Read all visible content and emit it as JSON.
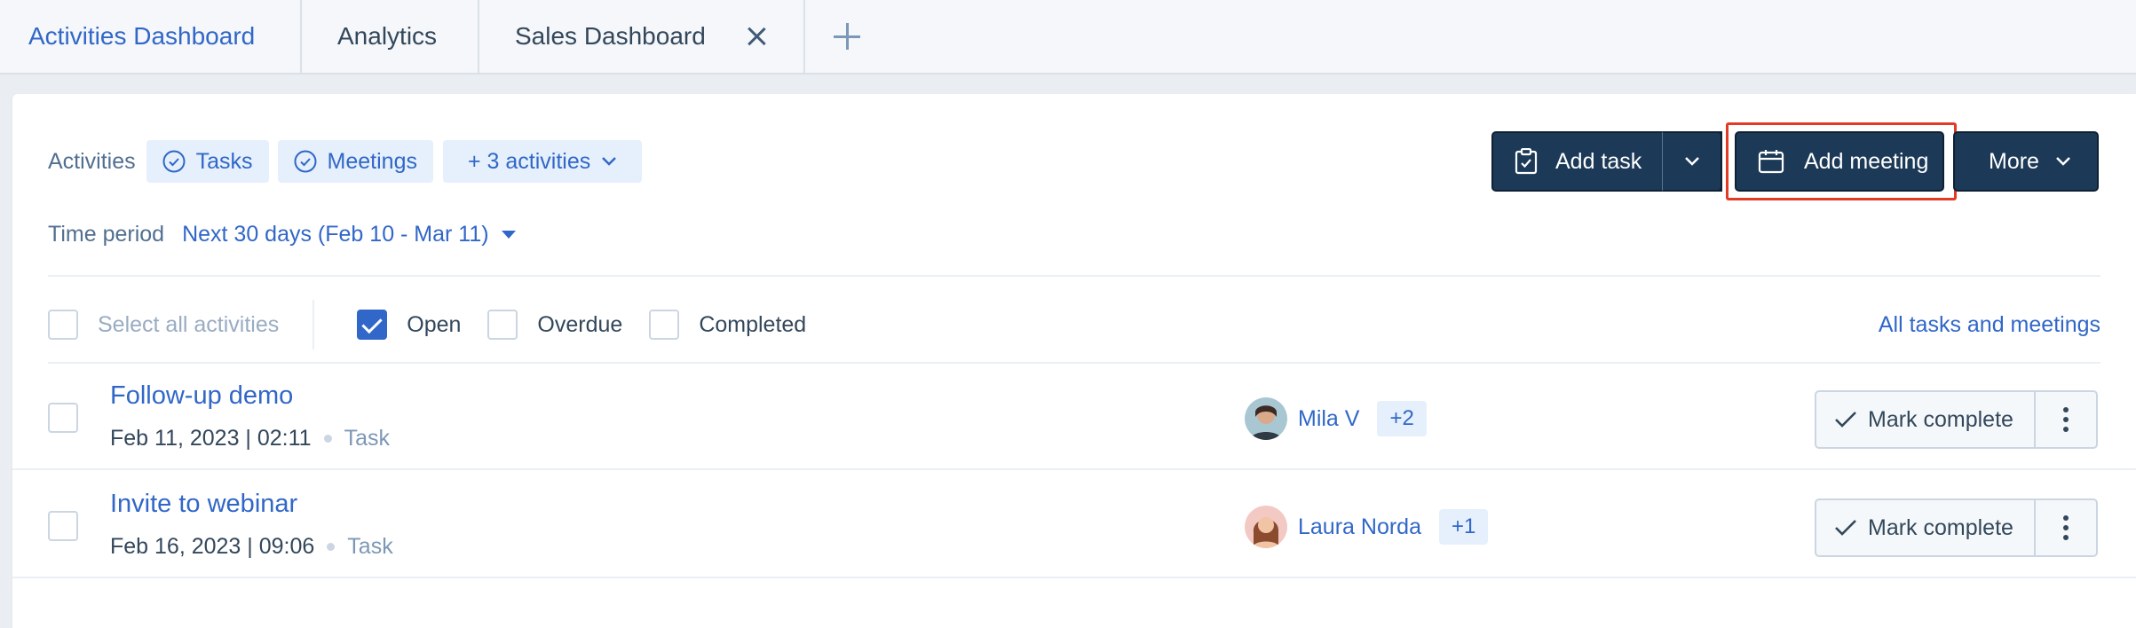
{
  "tabs": [
    {
      "label": "Activities Dashboard",
      "active": true
    },
    {
      "label": "Analytics",
      "active": false
    },
    {
      "label": "Sales Dashboard",
      "active": false
    }
  ],
  "filters": {
    "label": "Activities",
    "chips": [
      "Tasks",
      "Meetings"
    ],
    "more_chip": "+ 3 activities"
  },
  "time_period": {
    "label": "Time period",
    "value": "Next 30 days (Feb 10 - Mar 11)"
  },
  "toolbar": {
    "add_task": "Add task",
    "add_meeting": "Add meeting",
    "more": "More"
  },
  "status_filters": {
    "select_all": "Select all activities",
    "options": [
      {
        "label": "Open",
        "checked": true
      },
      {
        "label": "Overdue",
        "checked": false
      },
      {
        "label": "Completed",
        "checked": false
      }
    ],
    "all_link": "All tasks and meetings"
  },
  "activities": [
    {
      "title": "Follow-up demo",
      "datetime": "Feb 11, 2023 | 02:11",
      "type": "Task",
      "assignee": "Mila V",
      "extra": "+2",
      "action": "Mark complete"
    },
    {
      "title": "Invite to webinar",
      "datetime": "Feb 16, 2023 | 09:06",
      "type": "Task",
      "assignee": "Laura Norda",
      "extra": "+1",
      "action": "Mark complete"
    }
  ],
  "colors": {
    "accent": "#3167c8",
    "dark_button": "#1c3a57",
    "highlight": "#e23a24"
  }
}
